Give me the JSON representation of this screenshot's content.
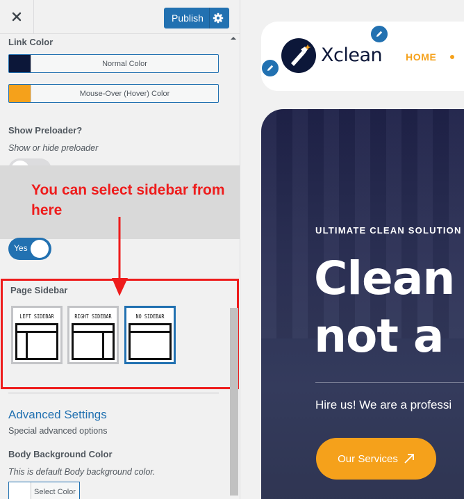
{
  "panel": {
    "close_icon": "close-icon",
    "publish_label": "Publish",
    "link_color": {
      "title": "Link Color",
      "normal_label": "Normal Color",
      "normal_color": "#0c1739",
      "hover_label": "Mouse-Over (Hover) Color",
      "hover_color": "#f5a11b"
    },
    "preloader": {
      "title": "Show Preloader?",
      "description": "Show or hide preloader"
    },
    "annotation": "You can select sidebar from here",
    "toggle_yes": "Yes",
    "page_sidebar": {
      "title": "Page Sidebar",
      "options": [
        {
          "label": "LEFT SIDEBAR",
          "selected": false
        },
        {
          "label": "RIGHT SIDEBAR",
          "selected": false
        },
        {
          "label": "NO SIDEBAR",
          "selected": true
        }
      ]
    },
    "advanced": {
      "title": "Advanced Settings",
      "description": "Special advanced options"
    },
    "body_bg": {
      "title": "Body Background Color",
      "description": "This is default Body background color.",
      "button_label": "Select Color"
    }
  },
  "preview": {
    "logo_text": "Xclean",
    "nav_home": "HOME",
    "hero_kicker": "ULTIMATE CLEAN SOLUTION",
    "hero_title_1": "Clean",
    "hero_title_2": "not a",
    "hero_sub": "Hire us! We are a professi",
    "cta_label": "Our Services",
    "accent_color": "#f5a11b",
    "brand_color": "#0c1739",
    "wp_blue": "#2271b1"
  }
}
